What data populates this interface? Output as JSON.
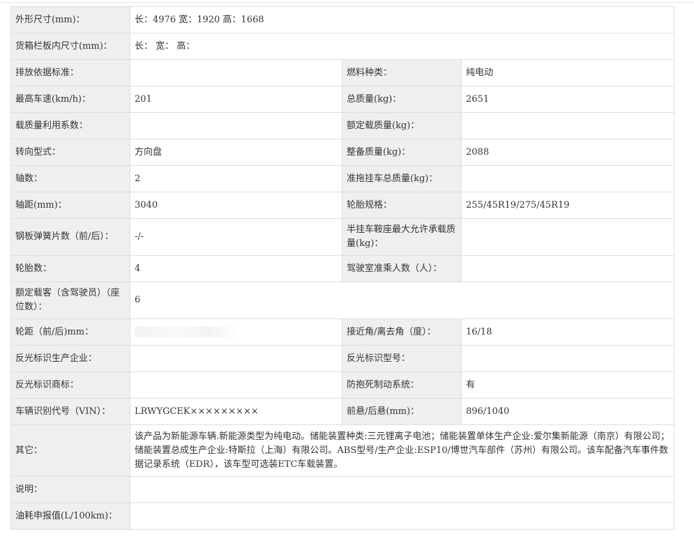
{
  "rows": {
    "dimensions": {
      "label": "外形尺寸(mm)：",
      "value": "长：4976 宽：1920 高：1668"
    },
    "cargo_box": {
      "label": "货箱栏板内尺寸(mm)：",
      "value": "长：  宽：  高："
    },
    "emission_std": {
      "label": "排放依据标准：",
      "value": ""
    },
    "fuel_type": {
      "label": "燃料种类：",
      "value": "纯电动"
    },
    "max_speed": {
      "label": "最高车速(km/h)：",
      "value": "201"
    },
    "total_mass": {
      "label": "总质量(kg)：",
      "value": "2651"
    },
    "load_util": {
      "label": "载质量利用系数：",
      "value": ""
    },
    "rated_load": {
      "label": "额定载质量(kg)：",
      "value": ""
    },
    "steering": {
      "label": "转向型式：",
      "value": "方向盘"
    },
    "curb_mass": {
      "label": "整备质量(kg)：",
      "value": "2088"
    },
    "axles": {
      "label": "轴数：",
      "value": "2"
    },
    "trailer_mass": {
      "label": "准拖挂车总质量(kg)：",
      "value": ""
    },
    "wheelbase": {
      "label": "轴距(mm)：",
      "value": "3040"
    },
    "tire_spec": {
      "label": "轮胎规格：",
      "value": "255/45R19/275/45R19"
    },
    "leaf_springs": {
      "label": "钢板弹簧片数（前/后）：",
      "value": "-/-"
    },
    "saddle_load": {
      "label": "半挂车鞍座最大允许承载质量(kg)：",
      "value": ""
    },
    "tire_count": {
      "label": "轮胎数：",
      "value": "4"
    },
    "cab_passengers": {
      "label": "驾驶室准乘人数（人）：",
      "value": ""
    },
    "passengers": {
      "label": "额定载客（含驾驶员）（座位数）：",
      "value": "6"
    },
    "track": {
      "label": "轮距（前/后)mm：",
      "value": ""
    },
    "angles": {
      "label": "接近角/离去角（度）：",
      "value": "16/18"
    },
    "reflector_maker": {
      "label": "反光标识生产企业：",
      "value": ""
    },
    "reflector_model": {
      "label": "反光标识型号：",
      "value": ""
    },
    "reflector_brand": {
      "label": "反光标识商标：",
      "value": ""
    },
    "abs": {
      "label": "防抱死制动系统：",
      "value": "有"
    },
    "vin": {
      "label": "车辆识别代号（VIN）：",
      "value": "LRWYGCEK×××××××××"
    },
    "overhang": {
      "label": "前悬/后悬(mm)：",
      "value": "896/1040"
    },
    "other": {
      "label": "其它：",
      "value": "该产品为新能源车辆.新能源类型为纯电动。储能装置种类:三元锂离子电池；储能装置单体生产企业:爱尔集新能源（南京）有限公司；储能装置总成生产企业:特斯拉（上海）有限公司。ABS型号/生产企业:ESP10/博世汽车部件（苏州）有限公司。该车配备汽车事件数据记录系统（EDR），该车型可选装ETC车载装置。"
    },
    "note": {
      "label": "说明：",
      "value": ""
    },
    "fuel_consumption": {
      "label": "油耗申报值(L/100km)：",
      "value": ""
    }
  }
}
